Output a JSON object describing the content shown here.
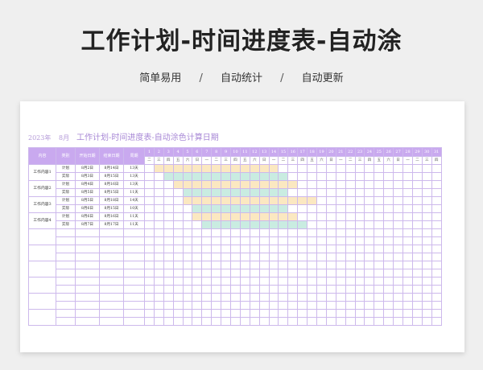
{
  "title": "工作计划-时间进度表-自动涂",
  "features": [
    "简单易用",
    "自动统计",
    "自动更新"
  ],
  "feature_sep": "/",
  "sheet": {
    "year": "2023年",
    "month": "8月",
    "subtitle": "工作计划-时间进度表-自动涂色计算日期"
  },
  "headers": [
    "内容",
    "类别",
    "开始日期",
    "结束日期",
    "周期"
  ],
  "days": [
    "1",
    "2",
    "3",
    "4",
    "5",
    "6",
    "7",
    "8",
    "9",
    "10",
    "11",
    "12",
    "13",
    "14",
    "15",
    "16",
    "17",
    "18",
    "19",
    "20",
    "21",
    "22",
    "23",
    "24",
    "25",
    "26",
    "27",
    "28",
    "29",
    "30",
    "31"
  ],
  "weekdays": [
    "二",
    "三",
    "四",
    "五",
    "六",
    "日",
    "一",
    "二",
    "三",
    "四",
    "五",
    "六",
    "日",
    "一",
    "二",
    "三",
    "四",
    "五",
    "六",
    "日",
    "一",
    "二",
    "三",
    "四",
    "五",
    "六",
    "日",
    "一",
    "二",
    "三",
    "四"
  ],
  "rows": [
    {
      "content": "工作内容1",
      "type": "计划",
      "start": "8月2日",
      "end": "8月14日",
      "cycle": "13天",
      "bar_start": 2,
      "bar_end": 14,
      "color": "#fbe8c1"
    },
    {
      "content": "",
      "type": "实际",
      "start": "8月3日",
      "end": "8月15日",
      "cycle": "13天",
      "bar_start": 3,
      "bar_end": 15,
      "color": "#c9ece1"
    },
    {
      "content": "工作内容2",
      "type": "计划",
      "start": "8月4日",
      "end": "8月16日",
      "cycle": "13天",
      "bar_start": 4,
      "bar_end": 16,
      "color": "#fbe8c1"
    },
    {
      "content": "",
      "type": "实际",
      "start": "8月5日",
      "end": "8月15日",
      "cycle": "11天",
      "bar_start": 5,
      "bar_end": 15,
      "color": "#c9ece1"
    },
    {
      "content": "工作内容3",
      "type": "计划",
      "start": "8月5日",
      "end": "8月18日",
      "cycle": "14天",
      "bar_start": 5,
      "bar_end": 18,
      "color": "#fbe8c1"
    },
    {
      "content": "",
      "type": "实际",
      "start": "8月6日",
      "end": "8月15日",
      "cycle": "10天",
      "bar_start": 6,
      "bar_end": 15,
      "color": "#c9ece1"
    },
    {
      "content": "工作内容4",
      "type": "计划",
      "start": "8月6日",
      "end": "8月16日",
      "cycle": "11天",
      "bar_start": 6,
      "bar_end": 16,
      "color": "#fbe8c1"
    },
    {
      "content": "",
      "type": "实际",
      "start": "8月7日",
      "end": "8月17日",
      "cycle": "11天",
      "bar_start": 7,
      "bar_end": 17,
      "color": "#c9ece1"
    }
  ],
  "empty_rows": 12,
  "colors": {
    "header": "#c9a9ef",
    "plan": "#fbe8c1",
    "actual": "#c9ece1",
    "border": "#cdb9ec"
  }
}
